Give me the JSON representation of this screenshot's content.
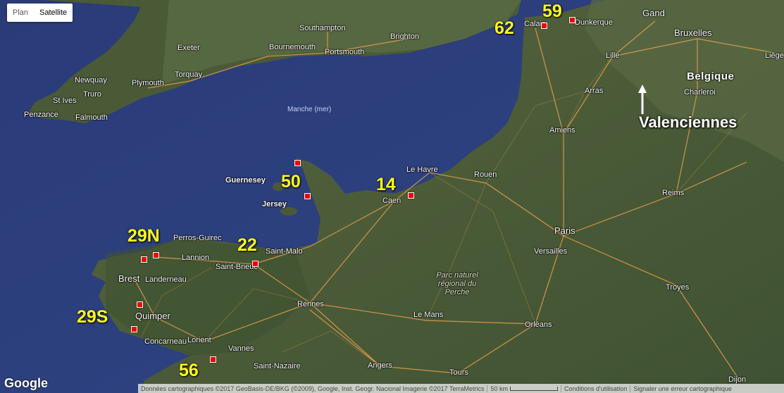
{
  "map_type_control": {
    "plan_label": "Plan",
    "satellite_label": "Satellite",
    "selected": "Satellite"
  },
  "places": {
    "southampton": "Southampton",
    "brighton": "Brighton",
    "exeter": "Exeter",
    "bournemouth": "Bournemouth",
    "portsmouth": "Portsmouth",
    "torquay": "Torquay",
    "plymouth": "Plymouth",
    "newquay": "Newquay",
    "st_ives": "St Ives",
    "truro": "Truro",
    "penzance": "Penzance",
    "falmouth": "Falmouth",
    "manche": "Manche (mer)",
    "calais": "Calais",
    "dunkerque": "Dunkerque",
    "gand": "Gand",
    "bruxelles": "Bruxelles",
    "lille": "Lille",
    "liege": "Liège",
    "belgique": "Belgique",
    "charleroi": "Charleroi",
    "arras": "Arras",
    "amiens": "Amiens",
    "le_havre": "Le Havre",
    "rouen": "Rouen",
    "guernesey": "Guernesey",
    "jersey": "Jersey",
    "caen": "Caen",
    "reims": "Reims",
    "perros_guirec": "Perros-Guirec",
    "lannion": "Lannion",
    "saint_malo": "Saint-Malo",
    "saint_brieuc": "Saint-Brieuc",
    "brest": "Brest",
    "landerneau": "Landerneau",
    "paris": "Paris",
    "versailles": "Versailles",
    "parc_naturel": "Parc naturel régional du Perche",
    "troyes": "Troyes",
    "quimper": "Quimper",
    "rennes": "Rennes",
    "le_mans": "Le Mans",
    "concarneau": "Concarneau",
    "lorient": "Lorient",
    "vannes": "Vannes",
    "orleans": "Orléans",
    "angers": "Angers",
    "tours": "Tours",
    "saint_nazaire": "Saint-Nazaire",
    "dijon": "Dijon"
  },
  "departments": {
    "d59": "59",
    "d62": "62",
    "d50": "50",
    "d14": "14",
    "d29n": "29N",
    "d22": "22",
    "d29s": "29S",
    "d56": "56"
  },
  "annotation": {
    "valenciennes": "Valenciennes"
  },
  "footer": {
    "google": "Google",
    "attribution": "Données cartographiques ©2017 GeoBasis-DE/BKG (©2009), Google, Inst. Geogr. Nacional Imagerie ©2017 TerraMetrics",
    "scale": "50 km",
    "terms": "Conditions d'utilisation",
    "report": "Signaler une erreur cartographique"
  },
  "colors": {
    "sea": "#2d3e7a",
    "land": "#4e5f3c",
    "roads": "#e9a04b",
    "labels": "#ffff1a",
    "marker": "#e00000"
  }
}
